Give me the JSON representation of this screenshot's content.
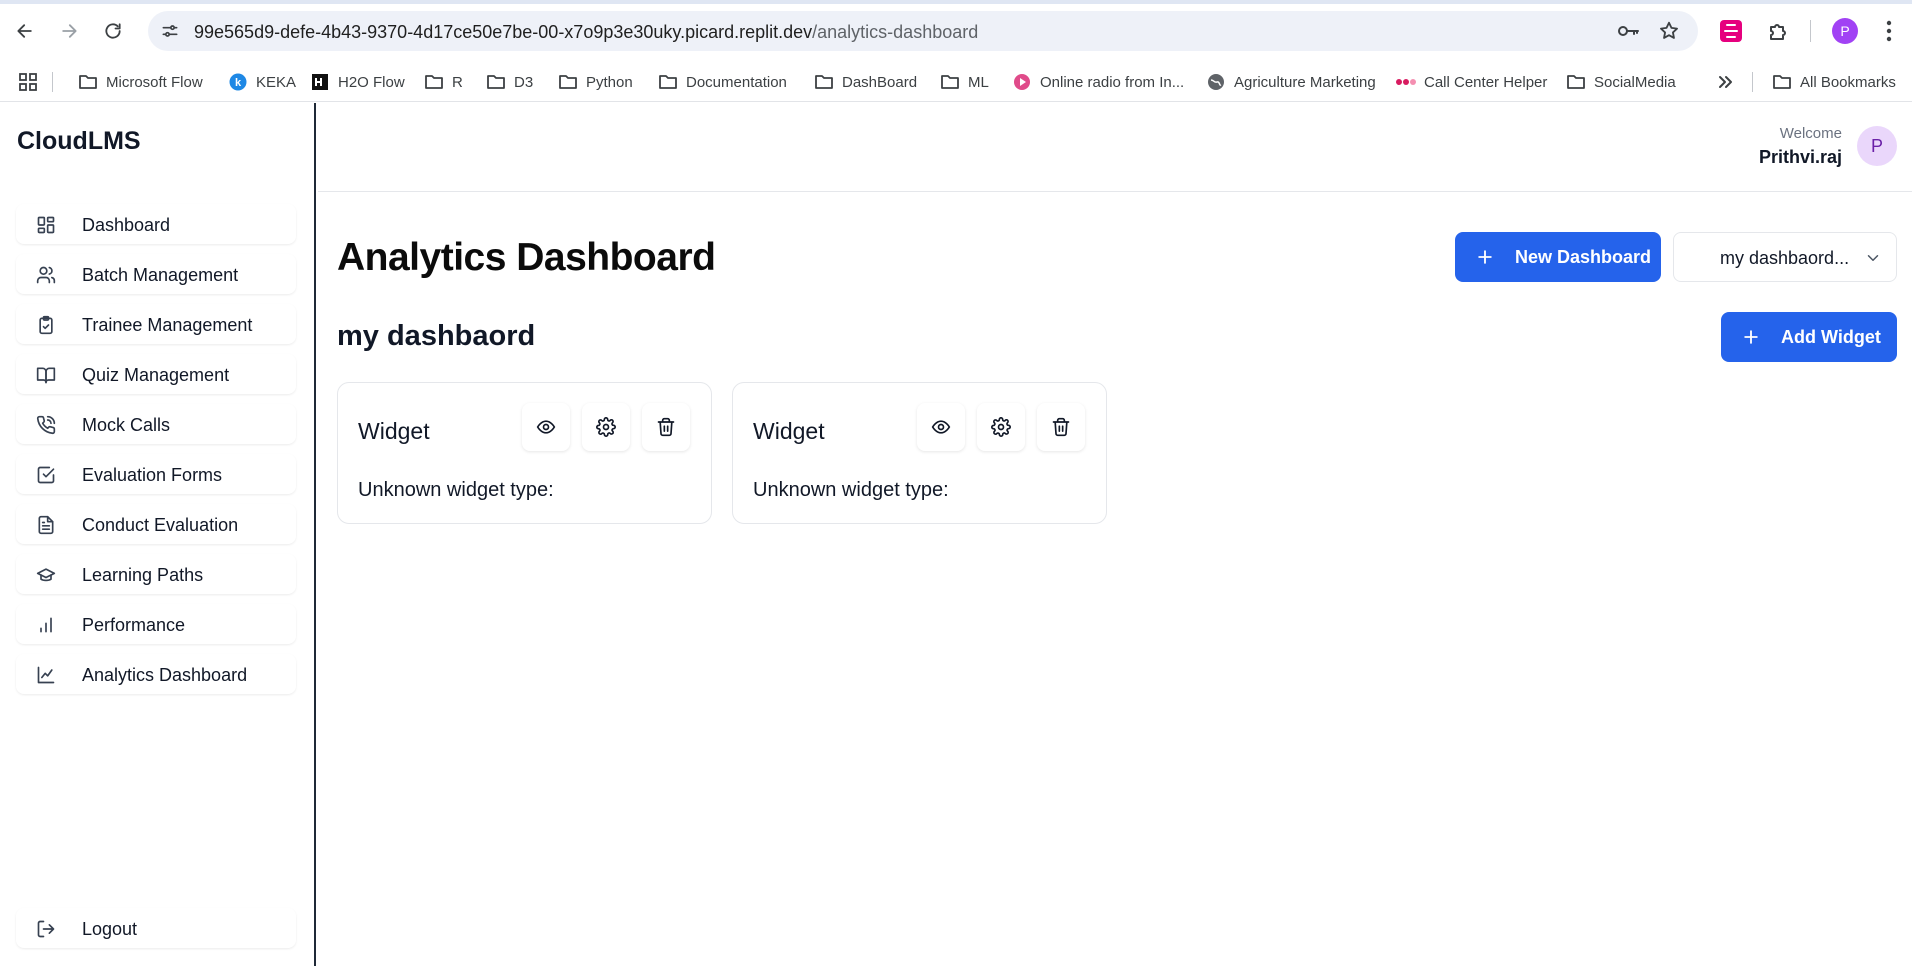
{
  "browser": {
    "url_host": "99e565d9-defe-4b43-9370-4d17ce50e7be-00-x7o9p3e30uky.picard.replit.dev",
    "url_path": "/analytics-dashboard",
    "profile_initial": "P",
    "bookmarks": [
      {
        "label": "Microsoft Flow",
        "icon": "folder-icon"
      },
      {
        "label": "KEKA",
        "icon": "keka-icon"
      },
      {
        "label": "H2O Flow",
        "icon": "h2o-icon"
      },
      {
        "label": "R",
        "icon": "folder-icon"
      },
      {
        "label": "D3",
        "icon": "folder-icon"
      },
      {
        "label": "Python",
        "icon": "folder-icon"
      },
      {
        "label": "Documentation",
        "icon": "folder-icon"
      },
      {
        "label": "DashBoard",
        "icon": "folder-icon"
      },
      {
        "label": "ML",
        "icon": "folder-icon"
      },
      {
        "label": "Online radio from In...",
        "icon": "radio-icon"
      },
      {
        "label": "Agriculture Marketing",
        "icon": "globe-icon"
      },
      {
        "label": "Call Center Helper",
        "icon": "dots-icon"
      },
      {
        "label": "SocialMedia",
        "icon": "folder-icon"
      }
    ],
    "all_bookmarks_label": "All Bookmarks"
  },
  "app": {
    "brand": "CloudLMS",
    "nav": [
      {
        "label": "Dashboard",
        "icon": "grid-icon"
      },
      {
        "label": "Batch Management",
        "icon": "users-icon"
      },
      {
        "label": "Trainee Management",
        "icon": "clipboard-check-icon"
      },
      {
        "label": "Quiz Management",
        "icon": "book-open-icon"
      },
      {
        "label": "Mock Calls",
        "icon": "phone-call-icon"
      },
      {
        "label": "Evaluation Forms",
        "icon": "check-square-icon"
      },
      {
        "label": "Conduct Evaluation",
        "icon": "file-text-icon"
      },
      {
        "label": "Learning Paths",
        "icon": "graduation-cap-icon"
      },
      {
        "label": "Performance",
        "icon": "bar-chart-icon"
      },
      {
        "label": "Analytics Dashboard",
        "icon": "line-chart-icon"
      }
    ],
    "logout_label": "Logout",
    "welcome_label": "Welcome",
    "user_name": "Prithvi.raj",
    "user_initial": "P"
  },
  "main": {
    "title": "Analytics Dashboard",
    "new_dashboard_label": "New Dashboard",
    "dashboard_select_value": "my dashbaord...",
    "dashboard_name": "my dashbaord",
    "add_widget_label": "Add Widget",
    "widgets": [
      {
        "title": "Widget",
        "body": "Unknown widget type:"
      },
      {
        "title": "Widget",
        "body": "Unknown widget type:"
      }
    ]
  },
  "colors": {
    "primary": "#2563eb",
    "avatar_bg": "#ead7fb",
    "profile_dot": "#a142f4"
  }
}
